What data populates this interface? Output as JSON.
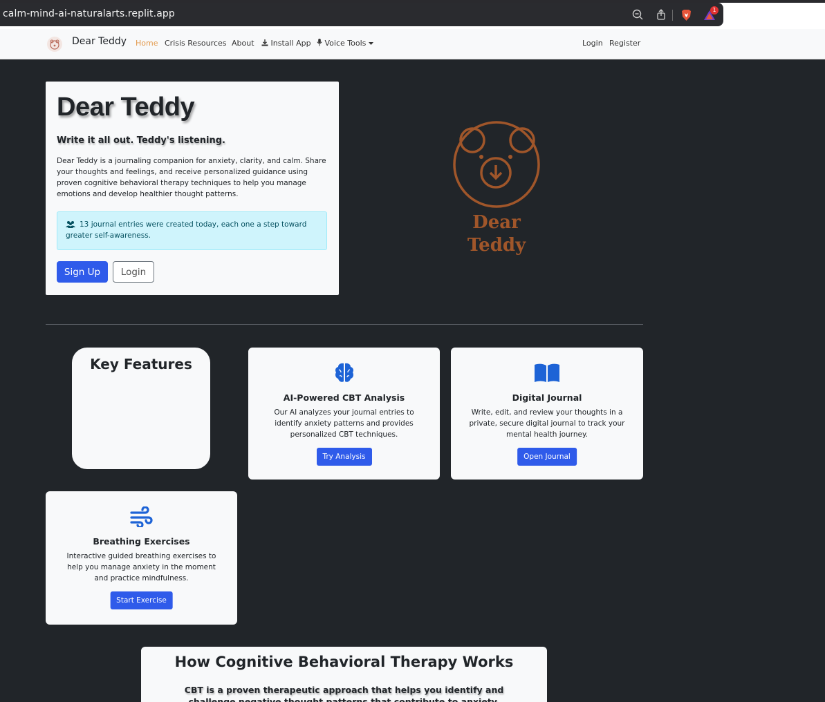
{
  "browser": {
    "url": "calm-mind-ai-naturalarts.replit.app",
    "notification_badge": "1"
  },
  "navbar": {
    "brand": "Dear Teddy",
    "links": [
      "Home",
      "Crisis Resources",
      "About",
      "Install App",
      "Voice Tools"
    ],
    "auth": [
      "Login",
      "Register"
    ]
  },
  "hero": {
    "title": "Dear Teddy",
    "subtitle": "Write it all out. Teddy's listening.",
    "description": "Dear Teddy is a journaling companion for anxiety, clarity, and calm. Share your thoughts and feelings, and receive personalized guidance using proven cognitive behavioral therapy techniques to help you manage emotions and develop healthier thought patterns.",
    "alert": "13 journal entries were created today, each one a step toward greater self-awareness.",
    "signup_label": "Sign Up",
    "login_label": "Login"
  },
  "logo": {
    "line1": "Dear",
    "line2": "Teddy",
    "color": "#a0562a"
  },
  "features": {
    "heading": "Key Features",
    "cards": [
      {
        "icon": "brain-icon",
        "title": "AI-Powered CBT Analysis",
        "text": "Our AI analyzes your journal entries to identify anxiety patterns and provides personalized CBT techniques.",
        "button": "Try Analysis"
      },
      {
        "icon": "book-icon",
        "title": "Digital Journal",
        "text": "Write, edit, and review your thoughts in a private, secure digital journal to track your mental health journey.",
        "button": "Open Journal"
      },
      {
        "icon": "wind-icon",
        "title": "Breathing Exercises",
        "text": "Interactive guided breathing exercises to help you manage anxiety in the moment and practice mindfulness.",
        "button": "Start Exercise"
      }
    ]
  },
  "cbt": {
    "title": "How Cognitive Behavioral Therapy Works",
    "description": "CBT is a proven therapeutic approach that helps you identify and challenge negative thought patterns that contribute to anxiety."
  },
  "colors": {
    "primary": "#2f5bea",
    "accent": "#e39a4d",
    "icon_blue": "#1d63d6",
    "bg_dark": "#212529"
  }
}
